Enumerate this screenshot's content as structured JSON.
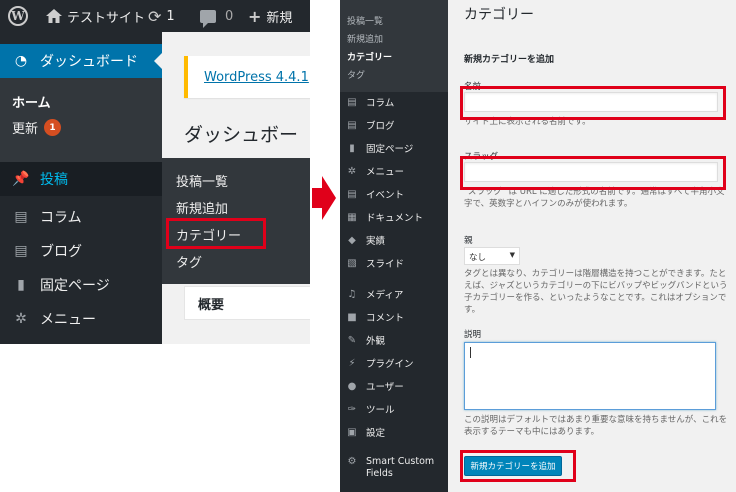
{
  "left_panel": {
    "admin_bar": {
      "site_name": "テストサイト",
      "updates_count": "1",
      "comments_count": "0",
      "new_label": "新規"
    },
    "menu": {
      "dashboard": "ダッシュボード",
      "home": "ホーム",
      "updates": "更新",
      "updates_badge": "1",
      "posts": "投稿",
      "items": [
        {
          "label": "コラム",
          "icon": "layout-icon"
        },
        {
          "label": "ブログ",
          "icon": "layout-icon"
        },
        {
          "label": "固定ページ",
          "icon": "page-icon"
        },
        {
          "label": "メニュー",
          "icon": "palm-icon"
        }
      ]
    },
    "content": {
      "notice_link": "WordPress 4.4.1",
      "page_title": "ダッシュボー",
      "panel_title": "概要"
    },
    "posts_flyout": [
      "投稿一覧",
      "新規追加",
      "カテゴリー",
      "タグ"
    ]
  },
  "right_panel": {
    "submenu": [
      "投稿一覧",
      "新規追加",
      "カテゴリー",
      "タグ"
    ],
    "menu_items": [
      {
        "label": "コラム",
        "icon": "layout-icon"
      },
      {
        "label": "ブログ",
        "icon": "layout-icon"
      },
      {
        "label": "固定ページ",
        "icon": "page-icon"
      },
      {
        "label": "メニュー",
        "icon": "palm-icon"
      },
      {
        "label": "イベント",
        "icon": "layout-icon"
      },
      {
        "label": "ドキュメント",
        "icon": "document-icon"
      },
      {
        "label": "実績",
        "icon": "tag-icon"
      },
      {
        "label": "スライド",
        "icon": "slides-icon"
      },
      {
        "label": "メディア",
        "icon": "media-icon"
      },
      {
        "label": "コメント",
        "icon": "comment-icon"
      },
      {
        "label": "外観",
        "icon": "brush-icon"
      },
      {
        "label": "プラグイン",
        "icon": "plug-icon"
      },
      {
        "label": "ユーザー",
        "icon": "user-icon"
      },
      {
        "label": "ツール",
        "icon": "wrench-icon"
      },
      {
        "label": "設定",
        "icon": "settings-icon"
      },
      {
        "label": "Smart Custom Fields",
        "icon": "gear-icon"
      }
    ],
    "page_title": "カテゴリー",
    "form": {
      "section_title": "新規カテゴリーを追加",
      "name_label": "名前",
      "name_desc": "サイト上に表示される名前です。",
      "slug_label": "スラッグ",
      "slug_desc": "\"スラッグ\" は URL に適した形式の名前です。通常はすべて半角小文字で、英数字とハイフンのみが使われます。",
      "parent_label": "親",
      "parent_value": "なし",
      "parent_desc": "タグとは異なり、カテゴリーは階層構造を持つことができます。たとえば、ジャズというカテゴリーの下にビバップやビッグバンドという子カテゴリーを作る、といったようなことです。これはオプションです。",
      "desc_label": "説明",
      "desc_help": "この説明はデフォルトではあまり重要な意味を持ちませんが、これを表示するテーマも中にはあります。",
      "submit_label": "新規カテゴリーを追加"
    }
  },
  "colors": {
    "admin_dark": "#23282d",
    "submenu_bg": "#32373c",
    "accent_blue": "#0073aa",
    "highlight_red": "#e0001a"
  }
}
